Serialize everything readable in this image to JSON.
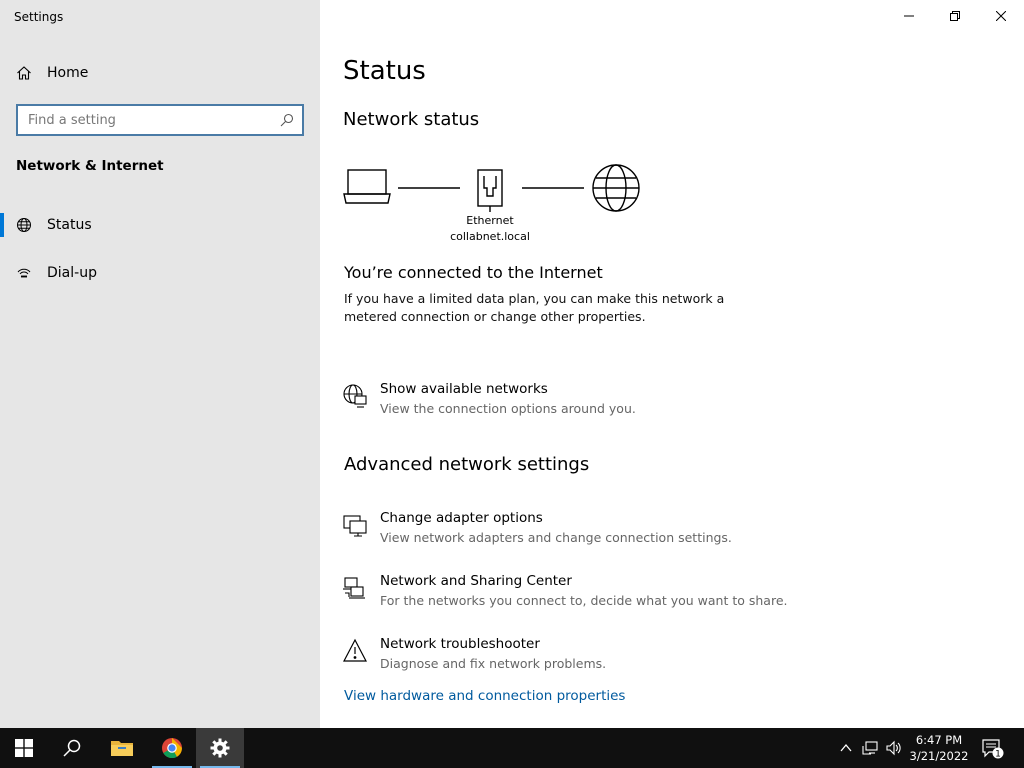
{
  "window": {
    "title": "Settings"
  },
  "sidebar": {
    "home_label": "Home",
    "search_placeholder": "Find a setting",
    "section_title": "Network & Internet",
    "items": [
      {
        "label": "Status",
        "icon": "globe-icon",
        "selected": true
      },
      {
        "label": "Dial-up",
        "icon": "dialup-icon",
        "selected": false
      }
    ]
  },
  "main": {
    "title": "Status",
    "network_status_title": "Network status",
    "diagram": {
      "adapter_name": "Ethernet",
      "domain": "collabnet.local"
    },
    "connected_heading": "You’re connected to the Internet",
    "connected_desc": "If you have a limited data plan, you can make this network a metered connection or change other properties.",
    "show_networks": {
      "title": "Show available networks",
      "desc": "View the connection options around you."
    },
    "advanced_title": "Advanced network settings",
    "advanced_items": [
      {
        "title": "Change adapter options",
        "desc": "View network adapters and change connection settings.",
        "icon": "adapter-icon"
      },
      {
        "title": "Network and Sharing Center",
        "desc": "For the networks you connect to, decide what you want to share.",
        "icon": "sharing-center-icon"
      },
      {
        "title": "Network troubleshooter",
        "desc": "Diagnose and fix network problems.",
        "icon": "warning-icon"
      }
    ],
    "hardware_link": "View hardware and connection properties"
  },
  "taskbar": {
    "time": "6:47 PM",
    "date": "3/21/2022",
    "notification_count": "1",
    "accent": "#0078d7"
  }
}
